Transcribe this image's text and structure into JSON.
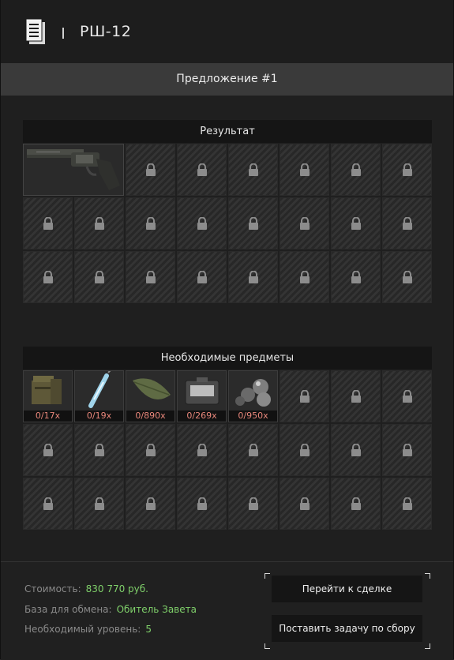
{
  "header": {
    "title": "РШ-12",
    "icon": "document-icon"
  },
  "offer": {
    "label": "Предложение #1"
  },
  "result": {
    "title": "Результат",
    "item": {
      "name": "РШ-12",
      "icon": "revolver-icon"
    }
  },
  "required": {
    "title": "Необходимые предметы",
    "items": [
      {
        "icon": "ammo-box-icon",
        "count": "0/17x"
      },
      {
        "icon": "syringe-icon",
        "count": "0/19x"
      },
      {
        "icon": "leaf-icon",
        "count": "0/890x"
      },
      {
        "icon": "tablet-case-icon",
        "count": "0/269x"
      },
      {
        "icon": "spheres-icon",
        "count": "0/950x"
      }
    ]
  },
  "footer": {
    "cost_label": "Стоимость:",
    "cost_value": "830 770 руб.",
    "base_label": "База для обмена:",
    "base_value": "Обитель Завета",
    "level_label": "Необходимый уровень:",
    "level_value": "5",
    "btn_deal": "Перейти к сделке",
    "btn_task": "Поставить задачу по сбору"
  },
  "colors": {
    "accent_green": "#7fd06a",
    "count_red": "#e9877b"
  }
}
